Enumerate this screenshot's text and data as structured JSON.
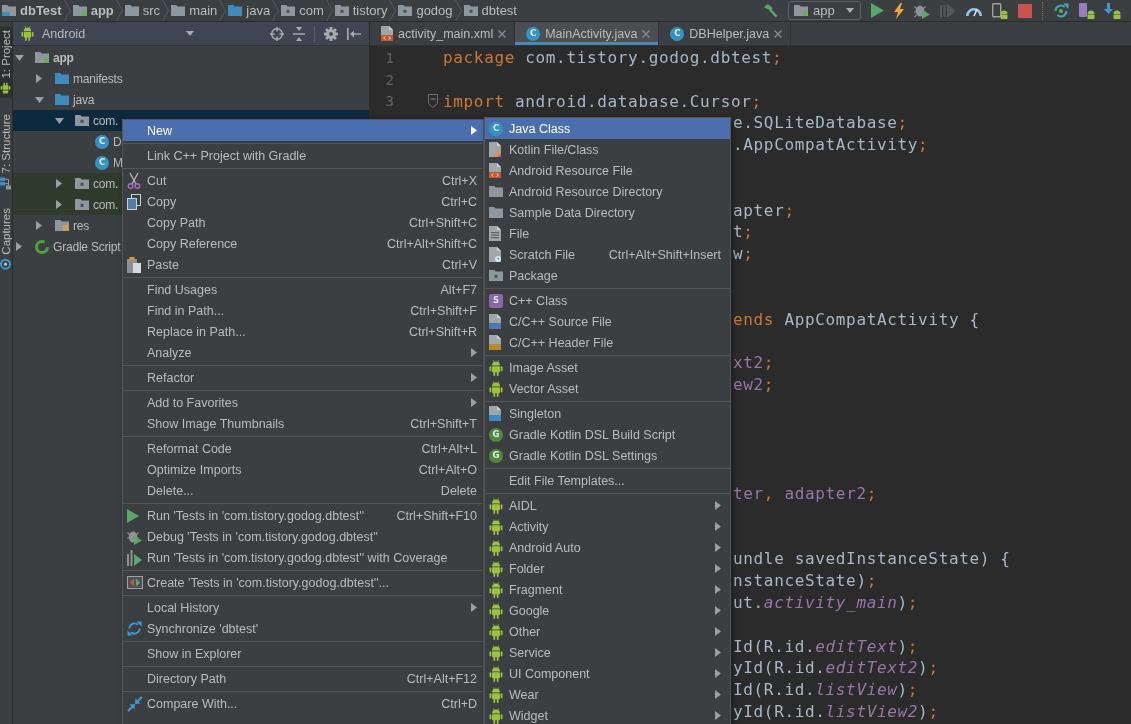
{
  "breadcrumbs": [
    {
      "label": "dbTest",
      "kind": "project",
      "bold": true
    },
    {
      "label": "app",
      "kind": "module",
      "bold": true
    },
    {
      "label": "src",
      "kind": "folder",
      "bold": false
    },
    {
      "label": "main",
      "kind": "folder",
      "bold": false
    },
    {
      "label": "java",
      "kind": "source-folder",
      "bold": false
    },
    {
      "label": "com",
      "kind": "package",
      "bold": false
    },
    {
      "label": "tistory",
      "kind": "package",
      "bold": false
    },
    {
      "label": "godog",
      "kind": "package",
      "bold": false
    },
    {
      "label": "dbtest",
      "kind": "package",
      "bold": false
    }
  ],
  "toolbar": {
    "run_configuration": "app"
  },
  "tool_window_tabs": [
    {
      "label": "1: Project",
      "kind": "robot",
      "selected": true
    },
    {
      "label": "7: Structure",
      "kind": "structure",
      "selected": false
    },
    {
      "label": "Captures",
      "kind": "capture",
      "selected": false
    }
  ],
  "project_panel": {
    "view": "Android",
    "tree": [
      {
        "label": "app",
        "kind": "module",
        "bold": true,
        "expanded": true,
        "selected": false,
        "test_source": false,
        "children": [
          {
            "label": "manifests",
            "kind": "source-folder",
            "bold": false,
            "expanded": false,
            "selected": false,
            "test_source": false
          },
          {
            "label": "java",
            "kind": "source-folder",
            "bold": false,
            "expanded": true,
            "selected": false,
            "test_source": false,
            "children": [
              {
                "label": "com.",
                "kind": "package",
                "bold": false,
                "expanded": true,
                "selected": true,
                "test_source": false,
                "children": [
                  {
                    "label": "D",
                    "kind": "class",
                    "icon_letter": "C",
                    "bold": false,
                    "selected": false,
                    "test_source": false
                  },
                  {
                    "label": "M",
                    "kind": "class",
                    "icon_letter": "C",
                    "bold": false,
                    "selected": false,
                    "test_source": false
                  }
                ]
              },
              {
                "label": "com.",
                "kind": "package",
                "bold": false,
                "expanded": false,
                "selected": false,
                "test_source": true
              },
              {
                "label": "com.",
                "kind": "package",
                "bold": false,
                "expanded": false,
                "selected": false,
                "test_source": true
              }
            ]
          },
          {
            "label": "res",
            "kind": "resource-folder",
            "bold": false,
            "expanded": false,
            "selected": false,
            "test_source": false
          }
        ]
      },
      {
        "label": "Gradle Script",
        "kind": "gradle",
        "bold": false,
        "expanded": false,
        "selected": false,
        "test_source": false
      }
    ]
  },
  "editor_tabs": [
    {
      "label": "activity_main.xml",
      "kind": "xml-file",
      "selected": false
    },
    {
      "label": "MainActivity.java",
      "kind": "class",
      "icon_letter": "C",
      "selected": true
    },
    {
      "label": "DBHelper.java",
      "kind": "class",
      "icon_letter": "C",
      "selected": false
    }
  ],
  "code_lines": [
    {
      "kind": "numbered",
      "number": "1",
      "tokens": [
        {
          "text": "package",
          "kind": "keyword"
        },
        {
          "text": " com.tistory.godog.dbtest",
          "kind": "plain"
        },
        {
          "text": ";",
          "kind": "punct"
        }
      ]
    },
    {
      "kind": "numbered",
      "number": "2"
    },
    {
      "kind": "numbered",
      "number": "3",
      "fold": true,
      "tokens": [
        {
          "text": "import",
          "kind": "keyword"
        },
        {
          "text": " android.database.Cursor",
          "kind": "plain"
        },
        {
          "text": ";",
          "kind": "punct"
        }
      ]
    },
    {
      "kind": "fragment",
      "tokens": [
        {
          "text": "e.SQLiteDatabase",
          "kind": "plain"
        },
        {
          "text": ";",
          "kind": "punct"
        }
      ]
    },
    {
      "kind": "fragment",
      "tokens": [
        {
          "text": ".AppCompatActivity",
          "kind": "plain"
        },
        {
          "text": ";",
          "kind": "punct"
        }
      ]
    },
    {
      "kind": "blank"
    },
    {
      "kind": "blank"
    },
    {
      "kind": "fragment",
      "tokens": [
        {
          "text": "apter",
          "kind": "plain"
        },
        {
          "text": ";",
          "kind": "punct"
        }
      ]
    },
    {
      "kind": "fragment",
      "tokens": [
        {
          "text": "t",
          "kind": "plain"
        },
        {
          "text": ";",
          "kind": "punct"
        }
      ]
    },
    {
      "kind": "fragment",
      "tokens": [
        {
          "text": "w",
          "kind": "plain"
        },
        {
          "text": ";",
          "kind": "punct"
        }
      ]
    },
    {
      "kind": "blank"
    },
    {
      "kind": "blank"
    },
    {
      "kind": "fragment",
      "tokens": [
        {
          "text": "ends",
          "kind": "keyword"
        },
        {
          "text": " AppCompatActivity {",
          "kind": "plain"
        }
      ]
    },
    {
      "kind": "blank"
    },
    {
      "kind": "fragment",
      "tokens": [
        {
          "text": "xt2",
          "kind": "field"
        },
        {
          "text": ";",
          "kind": "punct"
        }
      ]
    },
    {
      "kind": "fragment",
      "tokens": [
        {
          "text": "ew2",
          "kind": "field"
        },
        {
          "text": ";",
          "kind": "punct"
        }
      ]
    },
    {
      "kind": "blank"
    },
    {
      "kind": "blank"
    },
    {
      "kind": "blank"
    },
    {
      "kind": "blank"
    },
    {
      "kind": "fragment",
      "tokens": [
        {
          "text": "ter",
          "kind": "field"
        },
        {
          "text": ", ",
          "kind": "punct"
        },
        {
          "text": "adapter2",
          "kind": "field"
        },
        {
          "text": ";",
          "kind": "punct"
        }
      ]
    },
    {
      "kind": "blank"
    },
    {
      "kind": "blank"
    },
    {
      "kind": "fragment",
      "tokens": [
        {
          "text": "undle savedInstanceState) {",
          "kind": "plain"
        }
      ]
    },
    {
      "kind": "fragment",
      "tokens": [
        {
          "text": "nstanceState)",
          "kind": "plain"
        },
        {
          "text": ";",
          "kind": "punct"
        }
      ]
    },
    {
      "kind": "fragment",
      "tokens": [
        {
          "text": "ut.",
          "kind": "plain"
        },
        {
          "text": "activity_main",
          "kind": "static"
        },
        {
          "text": ")",
          "kind": "plain"
        },
        {
          "text": ";",
          "kind": "punct"
        }
      ]
    },
    {
      "kind": "blank"
    },
    {
      "kind": "fragment",
      "tokens": [
        {
          "text": "Id(R.id.",
          "kind": "plain"
        },
        {
          "text": "editText",
          "kind": "static"
        },
        {
          "text": ")",
          "kind": "plain"
        },
        {
          "text": ";",
          "kind": "punct"
        }
      ]
    },
    {
      "kind": "fragment",
      "tokens": [
        {
          "text": "yId(R.id.",
          "kind": "plain"
        },
        {
          "text": "editText2",
          "kind": "static"
        },
        {
          "text": ")",
          "kind": "plain"
        },
        {
          "text": ";",
          "kind": "punct"
        }
      ]
    },
    {
      "kind": "fragment",
      "tokens": [
        {
          "text": "Id(R.id.",
          "kind": "plain"
        },
        {
          "text": "listView",
          "kind": "static"
        },
        {
          "text": ")",
          "kind": "plain"
        },
        {
          "text": ";",
          "kind": "punct"
        }
      ]
    },
    {
      "kind": "fragment",
      "tokens": [
        {
          "text": "yId(R.id.",
          "kind": "plain"
        },
        {
          "text": "listView2",
          "kind": "static"
        },
        {
          "text": ")",
          "kind": "plain"
        },
        {
          "text": ";",
          "kind": "punct"
        }
      ]
    }
  ],
  "context_menu": {
    "groups": [
      [
        {
          "label": "New",
          "kind": "plain",
          "selected": true,
          "submenu": true
        }
      ],
      [
        {
          "label": "Link C++ Project with Gradle",
          "kind": "plain",
          "selected": false,
          "submenu": false
        }
      ],
      [
        {
          "label": "Cut",
          "shortcut": "Ctrl+X",
          "kind": "scissors",
          "selected": false,
          "submenu": false
        },
        {
          "label": "Copy",
          "shortcut": "Ctrl+C",
          "kind": "copy",
          "selected": false,
          "submenu": false
        },
        {
          "label": "Copy Path",
          "shortcut": "Ctrl+Shift+C",
          "kind": "plain",
          "selected": false,
          "submenu": false
        },
        {
          "label": "Copy Reference",
          "shortcut": "Ctrl+Alt+Shift+C",
          "kind": "plain",
          "selected": false,
          "submenu": false
        },
        {
          "label": "Paste",
          "shortcut": "Ctrl+V",
          "kind": "paste",
          "selected": false,
          "submenu": false
        }
      ],
      [
        {
          "label": "Find Usages",
          "shortcut": "Alt+F7",
          "kind": "plain",
          "selected": false,
          "submenu": false
        },
        {
          "label": "Find in Path...",
          "shortcut": "Ctrl+Shift+F",
          "kind": "plain",
          "selected": false,
          "submenu": false
        },
        {
          "label": "Replace in Path...",
          "shortcut": "Ctrl+Shift+R",
          "kind": "plain",
          "selected": false,
          "submenu": false
        },
        {
          "label": "Analyze",
          "kind": "plain",
          "selected": false,
          "submenu": true
        }
      ],
      [
        {
          "label": "Refactor",
          "kind": "plain",
          "selected": false,
          "submenu": true
        }
      ],
      [
        {
          "label": "Add to Favorites",
          "kind": "plain",
          "selected": false,
          "submenu": true
        },
        {
          "label": "Show Image Thumbnails",
          "shortcut": "Ctrl+Shift+T",
          "kind": "plain",
          "selected": false,
          "submenu": false
        }
      ],
      [
        {
          "label": "Reformat Code",
          "shortcut": "Ctrl+Alt+L",
          "kind": "plain",
          "selected": false,
          "submenu": false
        },
        {
          "label": "Optimize Imports",
          "shortcut": "Ctrl+Alt+O",
          "kind": "plain",
          "selected": false,
          "submenu": false
        },
        {
          "label": "Delete...",
          "shortcut": "Delete",
          "kind": "plain",
          "selected": false,
          "submenu": false
        }
      ],
      [
        {
          "label": "Run 'Tests in 'com.tistory.godog.dbtest''",
          "shortcut": "Ctrl+Shift+F10",
          "kind": "run",
          "selected": false,
          "submenu": false
        },
        {
          "label": "Debug 'Tests in 'com.tistory.godog.dbtest''",
          "kind": "debug",
          "selected": false,
          "submenu": false
        },
        {
          "label": "Run 'Tests in 'com.tistory.godog.dbtest'' with Coverage",
          "kind": "coverage",
          "selected": false,
          "submenu": false
        }
      ],
      [
        {
          "label": "Create 'Tests in 'com.tistory.godog.dbtest''...",
          "kind": "create-test",
          "selected": false,
          "submenu": false
        }
      ],
      [
        {
          "label": "Local History",
          "kind": "plain",
          "selected": false,
          "submenu": true
        },
        {
          "label": "Synchronize 'dbtest'",
          "kind": "sync",
          "selected": false,
          "submenu": false
        }
      ],
      [
        {
          "label": "Show in Explorer",
          "kind": "plain",
          "selected": false,
          "submenu": false
        }
      ],
      [
        {
          "label": "Directory Path",
          "shortcut": "Ctrl+Alt+F12",
          "kind": "plain",
          "selected": false,
          "submenu": false
        }
      ],
      [
        {
          "label": "Compare With...",
          "shortcut": "Ctrl+D",
          "kind": "compare",
          "selected": false,
          "submenu": false
        }
      ]
    ]
  },
  "submenu": {
    "groups": [
      [
        {
          "label": "Java Class",
          "kind": "class",
          "icon_letter": "C",
          "selected": true,
          "submenu": false
        },
        {
          "label": "Kotlin File/Class",
          "kind": "kotlin-file",
          "selected": false,
          "submenu": false
        },
        {
          "label": "Android Resource File",
          "kind": "resource-file",
          "selected": false,
          "submenu": false
        },
        {
          "label": "Android Resource Directory",
          "kind": "folder",
          "selected": false,
          "submenu": false
        },
        {
          "label": "Sample Data Directory",
          "kind": "folder",
          "selected": false,
          "submenu": false
        },
        {
          "label": "File",
          "kind": "file",
          "selected": false,
          "submenu": false
        },
        {
          "label": "Scratch File",
          "shortcut": "Ctrl+Alt+Shift+Insert",
          "kind": "scratch-file",
          "selected": false,
          "submenu": false
        },
        {
          "label": "Package",
          "kind": "package",
          "selected": false,
          "submenu": false
        }
      ],
      [
        {
          "label": "C++ Class",
          "kind": "cpp-class",
          "icon_letter": "S",
          "selected": false,
          "submenu": false
        },
        {
          "label": "C/C++ Source File",
          "kind": "cpp-source",
          "selected": false,
          "submenu": false
        },
        {
          "label": "C/C++ Header File",
          "kind": "cpp-header",
          "selected": false,
          "submenu": false
        }
      ],
      [
        {
          "label": "Image Asset",
          "kind": "android",
          "selected": false,
          "submenu": false
        },
        {
          "label": "Vector Asset",
          "kind": "android",
          "selected": false,
          "submenu": false
        }
      ],
      [
        {
          "label": "Singleton",
          "kind": "singleton-file",
          "selected": false,
          "submenu": false
        },
        {
          "label": "Gradle Kotlin DSL Build Script",
          "kind": "gradle-badge",
          "icon_letter": "G",
          "selected": false,
          "submenu": false
        },
        {
          "label": "Gradle Kotlin DSL Settings",
          "kind": "gradle-badge",
          "icon_letter": "G",
          "selected": false,
          "submenu": false
        }
      ],
      [
        {
          "label": "Edit File Templates...",
          "kind": "plain",
          "selected": false,
          "submenu": false
        }
      ],
      [
        {
          "label": "AIDL",
          "kind": "android",
          "selected": false,
          "submenu": true
        },
        {
          "label": "Activity",
          "kind": "android",
          "selected": false,
          "submenu": true
        },
        {
          "label": "Android Auto",
          "kind": "android",
          "selected": false,
          "submenu": true
        },
        {
          "label": "Folder",
          "kind": "android",
          "selected": false,
          "submenu": true
        },
        {
          "label": "Fragment",
          "kind": "android",
          "selected": false,
          "submenu": true
        },
        {
          "label": "Google",
          "kind": "android",
          "selected": false,
          "submenu": true
        },
        {
          "label": "Other",
          "kind": "android",
          "selected": false,
          "submenu": true
        },
        {
          "label": "Service",
          "kind": "android",
          "selected": false,
          "submenu": true
        },
        {
          "label": "UI Component",
          "kind": "android",
          "selected": false,
          "submenu": true
        },
        {
          "label": "Wear",
          "kind": "android",
          "selected": false,
          "submenu": true
        },
        {
          "label": "Widget",
          "kind": "android",
          "selected": false,
          "submenu": true
        }
      ]
    ]
  }
}
